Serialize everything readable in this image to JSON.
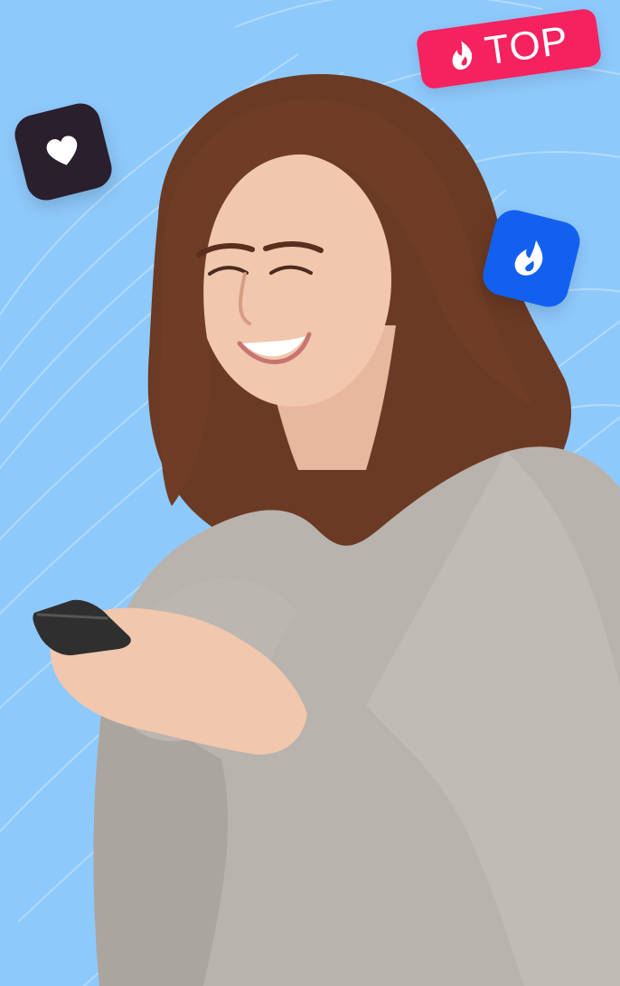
{
  "colors": {
    "background": "#8ec9fb",
    "line": "#b8defc",
    "top_badge": "#f5225f",
    "heart_tile": "#2a1f2d",
    "flame_tile": "#1360f0",
    "icon": "#ffffff",
    "hair": "#6b3a24",
    "sweater": "#b8b3ac",
    "skin": "#f1c7ae"
  },
  "badge": {
    "label": "TOP",
    "icon": "flame-icon"
  },
  "tiles": [
    {
      "icon": "heart-icon"
    },
    {
      "icon": "flame-icon"
    }
  ]
}
